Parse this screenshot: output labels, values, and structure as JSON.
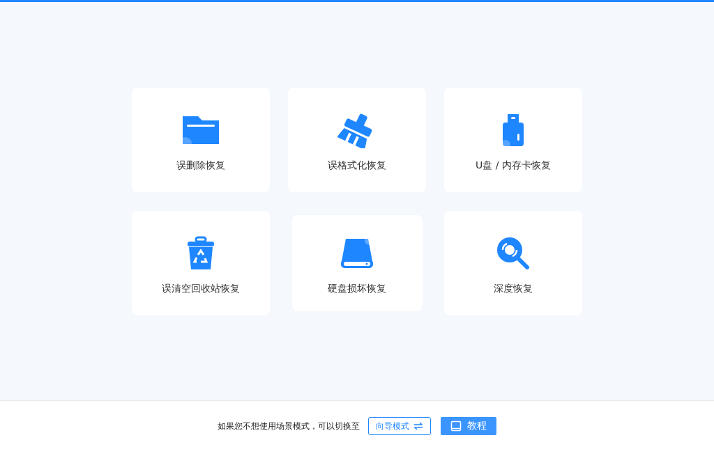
{
  "scenarios": [
    {
      "kind": "folder",
      "label": "误删除恢复",
      "pressed": false
    },
    {
      "kind": "broom",
      "label": "误格式化恢复",
      "pressed": false
    },
    {
      "kind": "usb",
      "label": "U盘 / 内存卡恢复",
      "pressed": false
    },
    {
      "kind": "bin",
      "label": "误清空回收站恢复",
      "pressed": false
    },
    {
      "kind": "disk",
      "label": "硬盘损坏恢复",
      "pressed": true
    },
    {
      "kind": "search",
      "label": "深度恢复",
      "pressed": false
    }
  ],
  "footer": {
    "hint": "如果您不想使用场景模式，可以切换至",
    "wizard_button": "向导模式",
    "tutorial_button": "教程"
  }
}
